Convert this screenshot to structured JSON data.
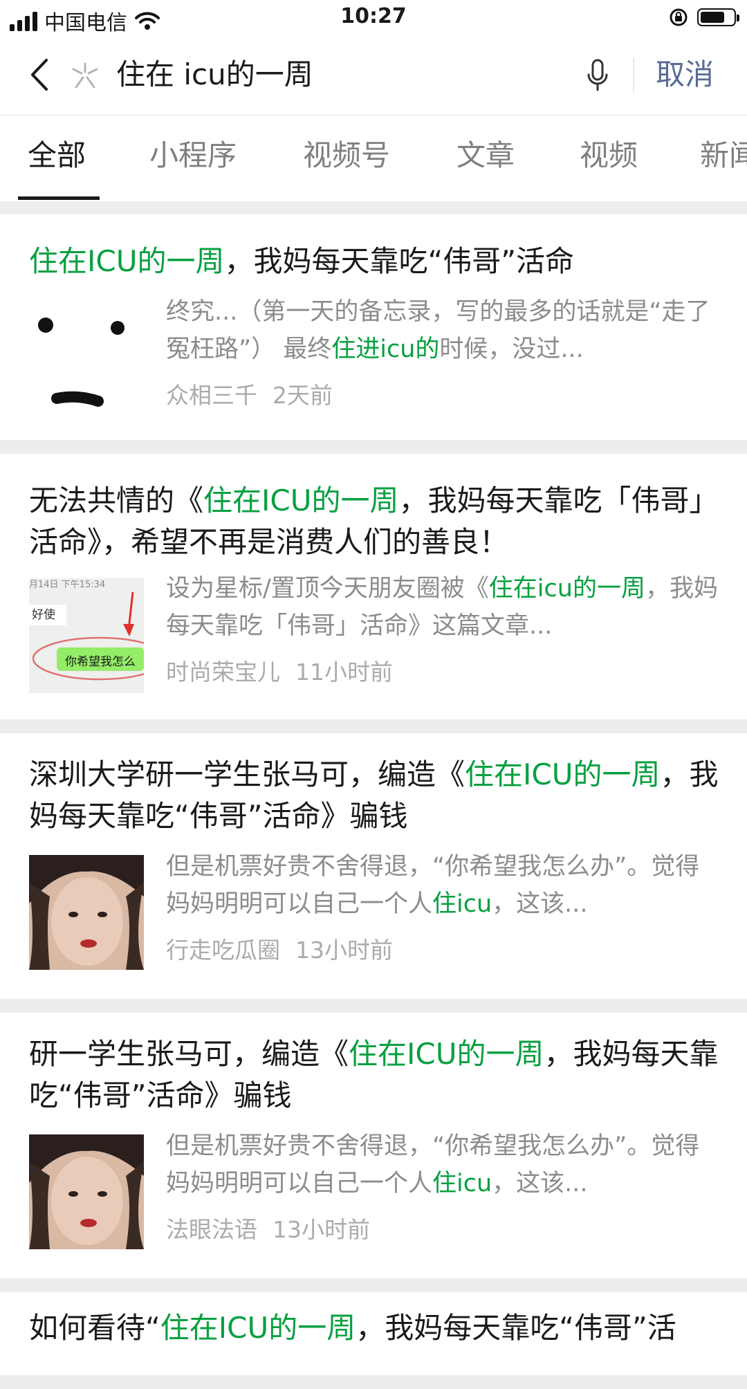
{
  "status_bar": {
    "carrier": "中国电信",
    "time": "10:27"
  },
  "search": {
    "query": "住在 icu的一周",
    "cancel_label": "取消"
  },
  "tabs": [
    {
      "label": "全部"
    },
    {
      "label": "小程序"
    },
    {
      "label": "视频号"
    },
    {
      "label": "文章"
    },
    {
      "label": "视频"
    },
    {
      "label": "新闻"
    }
  ],
  "results": [
    {
      "title_1": "住在ICU的一周",
      "title_2": "，我妈每天靠吃“伟哥”活命",
      "snippet_1": "终究...（第一天的备忘录，写的最多的话就是“走了冤枉路”） 最终",
      "snippet_2": "住进icu的",
      "snippet_3": "时候，没过...",
      "source": "众相三千",
      "time": "2天前"
    },
    {
      "title_1": "无法共情的《",
      "title_2": "住在ICU的一周",
      "title_3": "，我妈每天靠吃「伟哥」活命》，希望不再是消费人们的善良！",
      "snippet_1": "设为星标/置顶今天朋友圈被《",
      "snippet_2": "住在icu的一周",
      "snippet_3": "，我妈每天靠吃「伟哥」活命》这篇文章...",
      "thumb_text_1": "月14日 下午15:34",
      "thumb_text_2": "好使",
      "thumb_text_3": "你希望我怎么",
      "source": "时尚荣宝儿",
      "time": "11小时前"
    },
    {
      "title_1": "深圳大学研一学生张马可，编造《",
      "title_2": "住在ICU的一周",
      "title_3": "，我妈每天靠吃“伟哥”活命》骗钱",
      "snippet_1": "但是机票好贵不舍得退，“你希望我怎么办”。觉得妈妈明明可以自己一个人",
      "snippet_2": "住icu",
      "snippet_3": "，这该...",
      "source": "行走吃瓜圈",
      "time": "13小时前"
    },
    {
      "title_1": "研一学生张马可，编造《",
      "title_2": "住在ICU的一周",
      "title_3": "，我妈每天靠吃“伟哥”活命》骗钱",
      "snippet_1": "但是机票好贵不舍得退，“你希望我怎么办”。觉得妈妈明明可以自己一个人",
      "snippet_2": "住icu",
      "snippet_3": "，这该...",
      "source": "法眼法语",
      "time": "13小时前"
    },
    {
      "title_1": "如何看待“",
      "title_2": "住在ICU的一周",
      "title_3": "，我妈每天靠吃“伟哥”活"
    }
  ],
  "colors": {
    "highlight": "#07a040",
    "link": "#576b95",
    "muted": "#8c8c8c",
    "meta": "#ababab"
  }
}
